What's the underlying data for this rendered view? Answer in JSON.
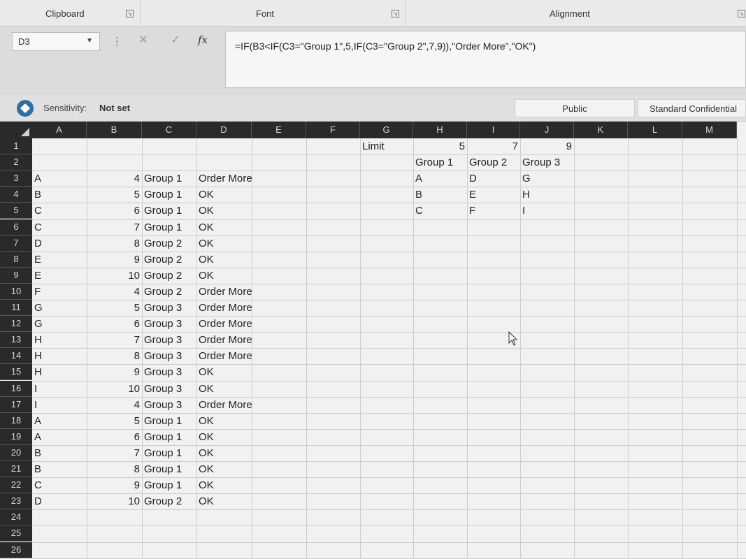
{
  "ribbon": {
    "groups": [
      "Clipboard",
      "Font",
      "Alignment"
    ]
  },
  "formula_bar": {
    "name_box": "D3",
    "cancel_icon": "✕",
    "enter_icon": "✓",
    "fx_label": "fx",
    "formula": "=IF(B3<IF(C3=\"Group 1\",5,IF(C3=\"Group 2\",7,9)),\"Order More\",\"OK\")"
  },
  "sensitivity": {
    "label": "Sensitivity:",
    "value": "Not set",
    "buttons": [
      "Public",
      "Standard Confidential"
    ]
  },
  "columns": [
    "A",
    "B",
    "C",
    "D",
    "E",
    "F",
    "G",
    "H",
    "I",
    "J",
    "K",
    "L",
    "M"
  ],
  "rows": [
    "1",
    "2",
    "3",
    "4",
    "5",
    "6",
    "7",
    "8",
    "9",
    "10",
    "11",
    "12",
    "13",
    "14",
    "15",
    "16",
    "17",
    "18",
    "19",
    "20",
    "21",
    "22",
    "23",
    "24",
    "25",
    "26"
  ],
  "table": [
    [
      "A",
      "4",
      "Group 1",
      "Order More"
    ],
    [
      "B",
      "5",
      "Group 1",
      "OK"
    ],
    [
      "C",
      "6",
      "Group 1",
      "OK"
    ],
    [
      "C",
      "7",
      "Group 1",
      "OK"
    ],
    [
      "D",
      "8",
      "Group 2",
      "OK"
    ],
    [
      "E",
      "9",
      "Group 2",
      "OK"
    ],
    [
      "E",
      "10",
      "Group 2",
      "OK"
    ],
    [
      "F",
      "4",
      "Group 2",
      "Order More"
    ],
    [
      "G",
      "5",
      "Group 3",
      "Order More"
    ],
    [
      "G",
      "6",
      "Group 3",
      "Order More"
    ],
    [
      "H",
      "7",
      "Group 3",
      "Order More"
    ],
    [
      "H",
      "8",
      "Group 3",
      "Order More"
    ],
    [
      "H",
      "9",
      "Group 3",
      "OK"
    ],
    [
      "I",
      "10",
      "Group 3",
      "OK"
    ],
    [
      "I",
      "4",
      "Group 3",
      "Order More"
    ],
    [
      "A",
      "5",
      "Group 1",
      "OK"
    ],
    [
      "A",
      "6",
      "Group 1",
      "OK"
    ],
    [
      "B",
      "7",
      "Group 1",
      "OK"
    ],
    [
      "B",
      "8",
      "Group 1",
      "OK"
    ],
    [
      "C",
      "9",
      "Group 1",
      "OK"
    ],
    [
      "D",
      "10",
      "Group 2",
      "OK"
    ]
  ],
  "lookup": {
    "limit_label": "Limit",
    "limits": [
      "5",
      "7",
      "9"
    ],
    "group_headers": [
      "Group 1",
      "Group 2",
      "Group 3"
    ],
    "members": [
      [
        "A",
        "D",
        "G"
      ],
      [
        "B",
        "E",
        "H"
      ],
      [
        "C",
        "F",
        "I"
      ]
    ]
  }
}
